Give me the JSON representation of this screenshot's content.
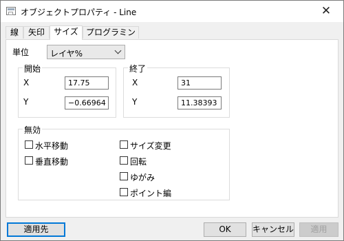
{
  "window": {
    "title": "オブジェクトプロパティ - Line",
    "close_glyph": "✕"
  },
  "tabs": [
    {
      "label": "線"
    },
    {
      "label": "矢印"
    },
    {
      "label": "サイズ"
    },
    {
      "label": "プログラミング"
    }
  ],
  "active_tab": "サイズ",
  "unit": {
    "label": "単位",
    "value": "レイヤ%"
  },
  "start_group": {
    "title": "開始",
    "x_label": "X",
    "x_value": "17.75",
    "y_label": "Y",
    "y_value": "−0.66964"
  },
  "end_group": {
    "title": "終了",
    "x_label": "X",
    "x_value": "31",
    "y_label": "Y",
    "y_value": "11.38393"
  },
  "disable_group": {
    "title": "無効",
    "options": [
      {
        "label": "水平移動",
        "checked": false
      },
      {
        "label": "垂直移動",
        "checked": false
      },
      {
        "label": "サイズ変更",
        "checked": false
      },
      {
        "label": "回転",
        "checked": false
      },
      {
        "label": "ゆがみ",
        "checked": false
      },
      {
        "label": "ポイント編",
        "checked": false
      }
    ]
  },
  "buttons": {
    "apply_to": "適用先",
    "ok": "OK",
    "cancel": "キャンセル",
    "apply": "適用"
  }
}
